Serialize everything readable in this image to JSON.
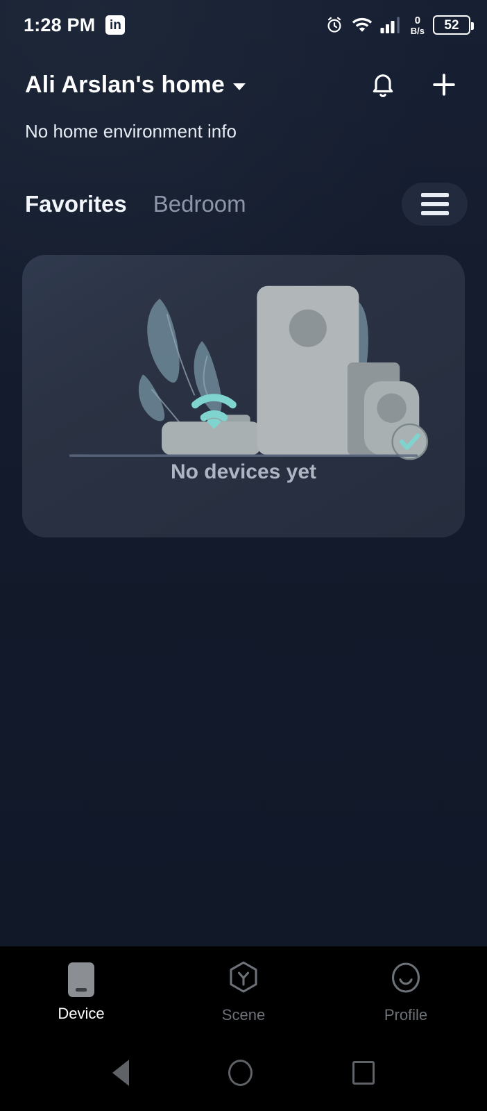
{
  "status_bar": {
    "time": "1:28 PM",
    "app_notification_icon": "linkedin-icon",
    "app_notification_label": "in",
    "alarm_icon": "alarm-clock-icon",
    "wifi_icon": "wifi-icon",
    "signal_icon": "cellular-signal-icon",
    "data_rate_value": "0",
    "data_rate_unit": "B/s",
    "battery_percent": "52"
  },
  "header": {
    "home_name": "Ali Arslan's home",
    "dropdown_icon": "chevron-down-icon",
    "notification_icon": "bell-icon",
    "add_icon": "plus-icon",
    "environment_info": "No home environment info"
  },
  "tabs": {
    "items": [
      {
        "label": "Favorites",
        "active": true
      },
      {
        "label": "Bedroom",
        "active": false
      }
    ],
    "menu_icon": "hamburger-menu-icon"
  },
  "empty_state": {
    "illustration": "no-devices-illustration",
    "message": "No devices yet"
  },
  "bottom_nav": {
    "items": [
      {
        "label": "Device",
        "icon": "device-icon",
        "active": true
      },
      {
        "label": "Scene",
        "icon": "scene-hexagon-icon",
        "active": false
      },
      {
        "label": "Profile",
        "icon": "profile-smiley-icon",
        "active": false
      }
    ]
  },
  "system_nav": {
    "back": "back-triangle-icon",
    "home": "home-circle-icon",
    "recents": "recents-square-icon"
  },
  "colors": {
    "page_background": "#121a2b",
    "card_background": "#2a3243",
    "accent_teal": "#7fd4cf",
    "active_text": "#ffffff",
    "inactive_text": "#8d97a9",
    "illustration_device": "#a9b0b2",
    "illustration_plant": "#6d8190"
  }
}
